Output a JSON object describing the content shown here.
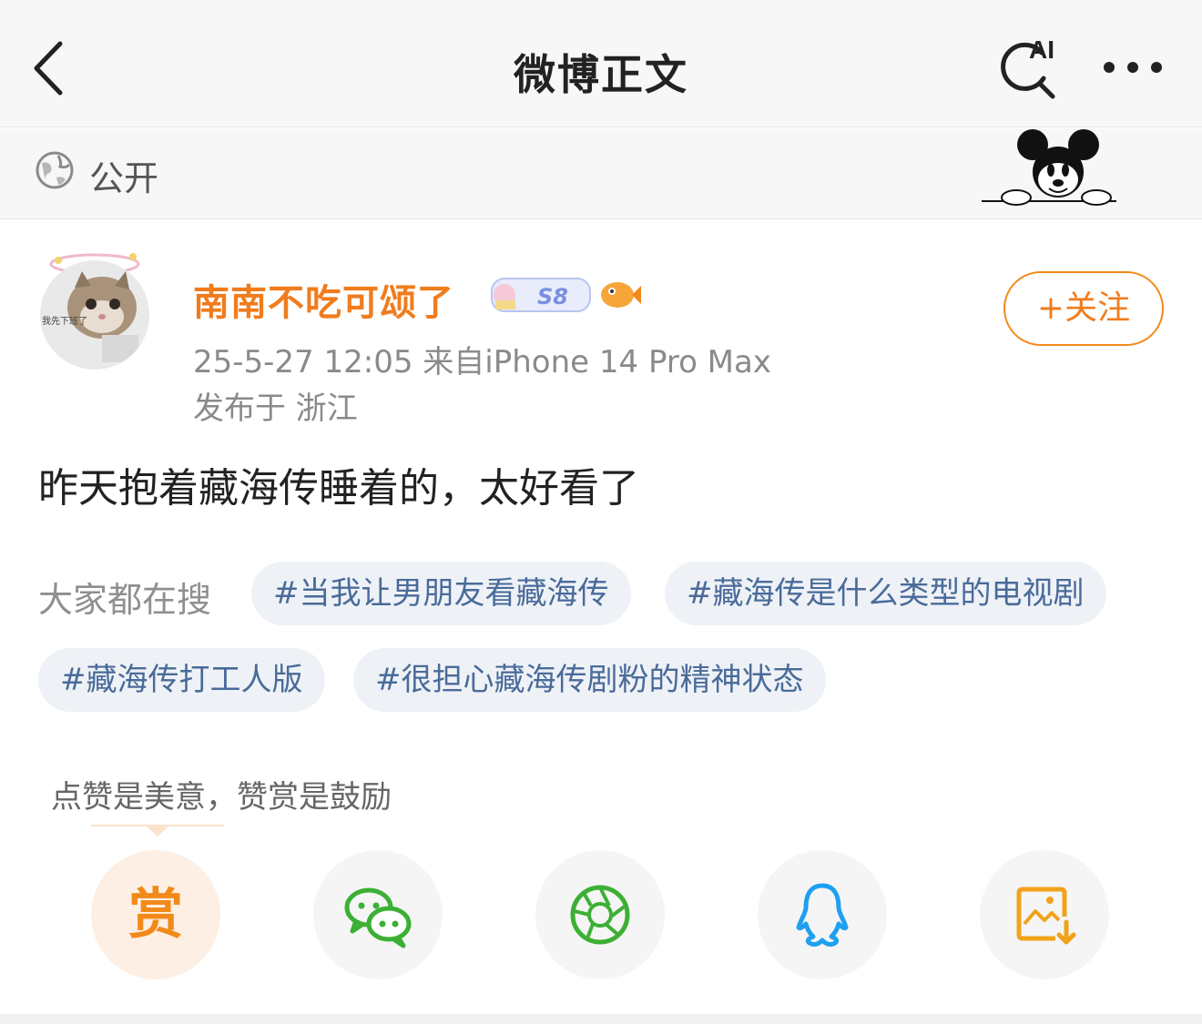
{
  "header": {
    "title": "微博正文",
    "ai_label": "AI"
  },
  "visibility": {
    "label": "公开"
  },
  "post": {
    "username": "南南不吃可颂了",
    "level_badge": "S8",
    "follow_label": "+关注",
    "time_source": "25-5-27 12:05  来自iPhone 14 Pro Max",
    "location": "发布于 浙江",
    "content": "昨天抱着藏海传睡着的，太好看了",
    "avatar_caption": "我先下班了"
  },
  "hot_search": {
    "label": "大家都在搜",
    "tags": [
      "#当我让男朋友看藏海传",
      "#藏海传是什么类型的电视剧",
      "#藏海传打工人版",
      "#很担心藏海传剧粉的精神状态"
    ]
  },
  "reward": {
    "hint": "点赞是美意，赞赏是鼓励",
    "button_label": "赏"
  },
  "share_icons": [
    "reward-icon",
    "wechat-icon",
    "moments-icon",
    "qq-icon",
    "save-image-icon"
  ],
  "colors": {
    "accent_orange": "#f07c1d",
    "tag_text": "#4a6b99",
    "tag_bg": "#eef2f7",
    "wechat_green": "#3cb034",
    "qq_blue": "#1ea0f0",
    "save_orange": "#f2a21a"
  }
}
